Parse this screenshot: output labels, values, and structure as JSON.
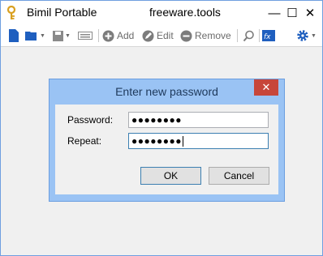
{
  "window": {
    "title": "Bimil Portable",
    "watermark": "freeware.tools",
    "minimize_glyph": "—",
    "maximize_glyph": "☐",
    "close_glyph": "✕"
  },
  "toolbar": {
    "add_label": "Add",
    "edit_label": "Edit",
    "remove_label": "Remove",
    "icons": [
      "new-file-icon",
      "open-folder-icon",
      "save-icon",
      "keyboard-icon",
      "add-icon",
      "edit-icon",
      "remove-icon",
      "search-icon",
      "fx-icon",
      "gear-icon"
    ]
  },
  "dialog": {
    "title": "Enter new password",
    "close_glyph": "✕",
    "password_label": "Password:",
    "password_value": "●●●●●●●●",
    "repeat_label": "Repeat:",
    "repeat_value": "●●●●●●●●",
    "ok_label": "OK",
    "cancel_label": "Cancel"
  },
  "colors": {
    "dialog_frame": "#9ac3f4",
    "close_red": "#c7463a",
    "accent_blue": "#2b6fc4"
  }
}
